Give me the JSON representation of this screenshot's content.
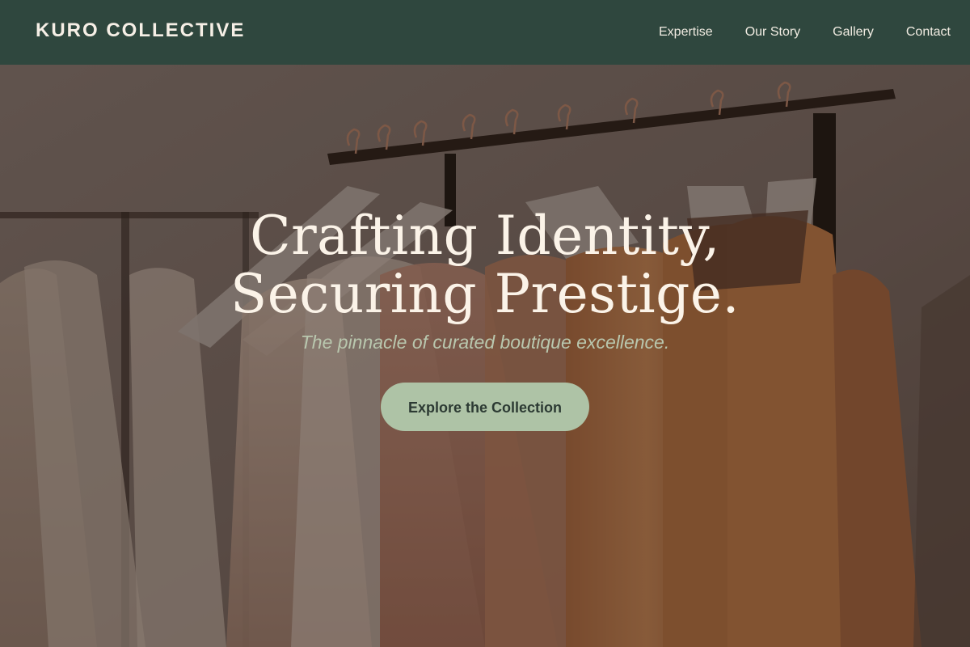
{
  "brand": {
    "name": "KURO COLLECTIVE"
  },
  "nav": {
    "items": [
      {
        "label": "Expertise"
      },
      {
        "label": "Our Story"
      },
      {
        "label": "Gallery"
      },
      {
        "label": "Contact"
      }
    ]
  },
  "hero": {
    "title_line1": "Crafting Identity,",
    "title_line2": "Securing Prestige.",
    "subtitle": "The pinnacle of curated boutique excellence.",
    "cta_label": "Explore the Collection"
  },
  "colors": {
    "nav_background": "#2f473e",
    "cta_background": "#aec3a6",
    "subtitle_text": "#b9c7ae",
    "title_text": "#fbf3e8"
  }
}
